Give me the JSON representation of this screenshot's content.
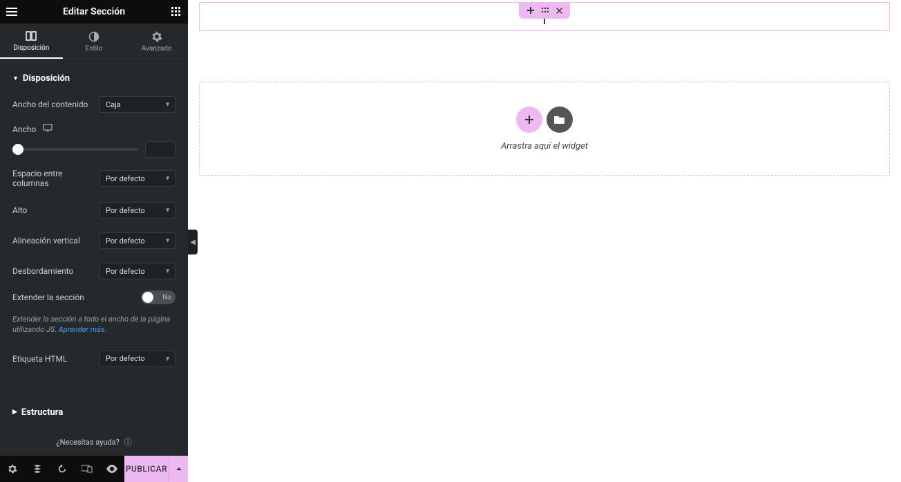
{
  "header": {
    "title": "Editar Sección"
  },
  "tabs": [
    {
      "label": "Disposición"
    },
    {
      "label": "Estilo"
    },
    {
      "label": "Avanzado"
    }
  ],
  "layout": {
    "section_title": "Disposición",
    "content_width_label": "Ancho del contenido",
    "content_width_value": "Caja",
    "width_label": "Ancho",
    "width_value": "",
    "column_gap_label": "Espacio entre columnas",
    "column_gap_value": "Por defecto",
    "height_label": "Alto",
    "height_value": "Por defecto",
    "valign_label": "Alineación vertical",
    "valign_value": "Por defecto",
    "overflow_label": "Desbordamiento",
    "overflow_value": "Por defecto",
    "extend_label": "Extender la sección",
    "extend_toggle": "No",
    "extend_help_prefix": "Extender la sección a todo el ancho de la página utilizando JS. ",
    "extend_help_link": "Aprender más.",
    "html_tag_label": "Etiqueta HTML",
    "html_tag_value": "Por defecto"
  },
  "structure": {
    "title": "Estructura"
  },
  "help": {
    "text": "¿Necesitas ayuda?"
  },
  "footer": {
    "publish": "PUBLICAR"
  },
  "canvas": {
    "drop_text": "Arrastra aquí el widget"
  }
}
